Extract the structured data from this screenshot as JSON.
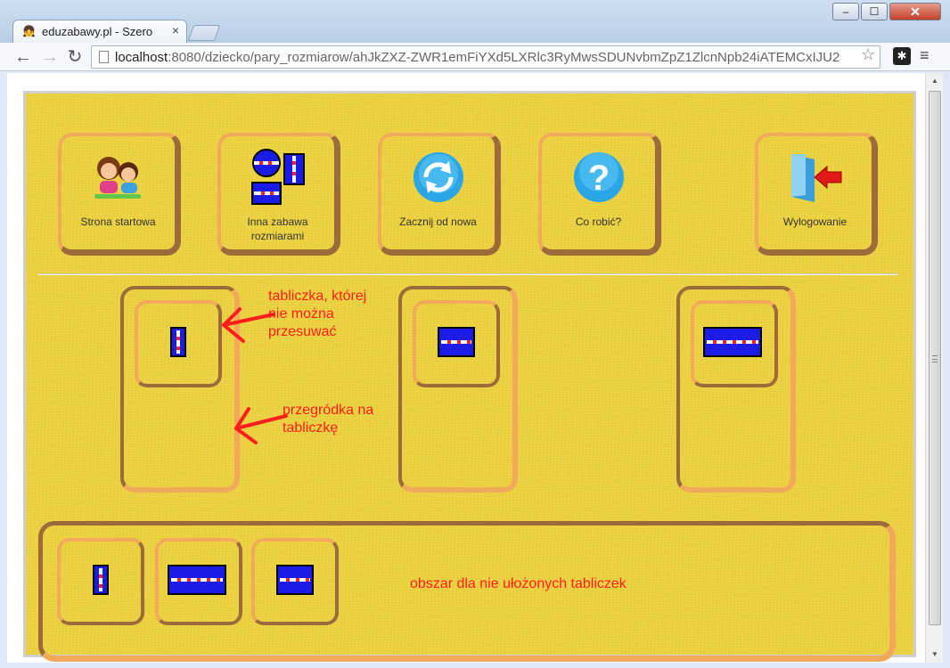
{
  "browser": {
    "tab_title": "eduzabawy.pl - Szero",
    "tab_close": "×",
    "url_host": "localhost",
    "url_rest": ":8080/dziecko/pary_rozmiarow/ahJkZXZ-ZWR1emFiYXd5LXRlc3RyMwsSDUNvbmZpZ1ZlcnNpb24iATEMCxIJU2",
    "minimize": "‒",
    "maximize": "☐",
    "close": "✕",
    "back": "←",
    "forward": "→",
    "reload": "↻",
    "star": "☆",
    "ext": "✱",
    "menu": "≡"
  },
  "menu_buttons": [
    {
      "label": "Strona startowa",
      "icon": "kids-logo-icon"
    },
    {
      "label": "Inna zabawa rozmiarami",
      "icon": "size-game-icon"
    },
    {
      "label": "Zacznij od nowa",
      "icon": "refresh-icon"
    },
    {
      "label": "Co robić?",
      "icon": "help-icon"
    },
    {
      "label": "Wylogowanie",
      "icon": "logout-icon"
    }
  ],
  "help_glyph": "?",
  "annotations": {
    "tile": "tabliczka, której\nnie można\nprzesuwać",
    "compartment": "przegródka na\ntabliczkę",
    "tray": "obszar dla nie ułożonych tabliczek"
  },
  "colors": {
    "board": "#ecd23f",
    "frame_light": "#f2a95b",
    "frame_dark": "#9c6b3c",
    "plate": "#1b1be6",
    "annotation": "#ff1d1d"
  }
}
